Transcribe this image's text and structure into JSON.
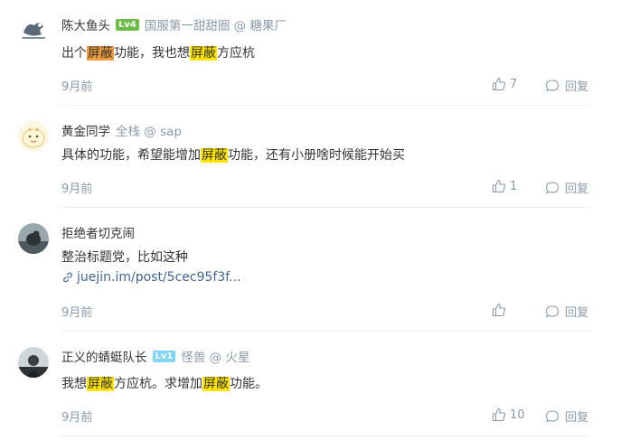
{
  "comments": [
    {
      "author": "陈大鱼头",
      "level": "Lv4",
      "level_color": "#6cbd45",
      "job": "国服第一甜甜圈 @ 糖果厂",
      "text": {
        "a": "出个",
        "h1": "屏蔽",
        "b": "功能，我也想",
        "h2": "屏蔽",
        "c": "方应杭"
      },
      "highlight_colors": [
        "#f09d3e",
        "#ffe400"
      ],
      "time": "9月前",
      "likes": "7",
      "reply_label": "回复"
    },
    {
      "author": "黄金同学",
      "job": "全栈 @ sap",
      "text": {
        "a": "具体的功能，希望能增加",
        "h1": "屏蔽",
        "b": "功能，还有小册啥时候能开始买"
      },
      "time": "9月前",
      "likes": "1",
      "reply_label": "回复"
    },
    {
      "author": "拒绝者切克闹",
      "text": {
        "a": "整治标题党，比如这种"
      },
      "link": "juejin.im/post/5cec95f3f...",
      "time": "9月前",
      "reply_label": "回复"
    },
    {
      "author": "正义的蜻蜓队长",
      "level": "Lv1",
      "level_color": "#7fd5f5",
      "job": "怪兽 @ 火星",
      "text": {
        "a": "我想",
        "h1": "屏蔽",
        "b": "方应杭。求增加",
        "h2": "屏蔽",
        "c": "功能。"
      },
      "time": "9月前",
      "likes": "10",
      "reply_label": "回复"
    }
  ],
  "colors": {
    "highlight_yellow": "#ffe400",
    "highlight_orange": "#f09d3e",
    "link": "#406599",
    "muted": "#8a9aa9"
  }
}
